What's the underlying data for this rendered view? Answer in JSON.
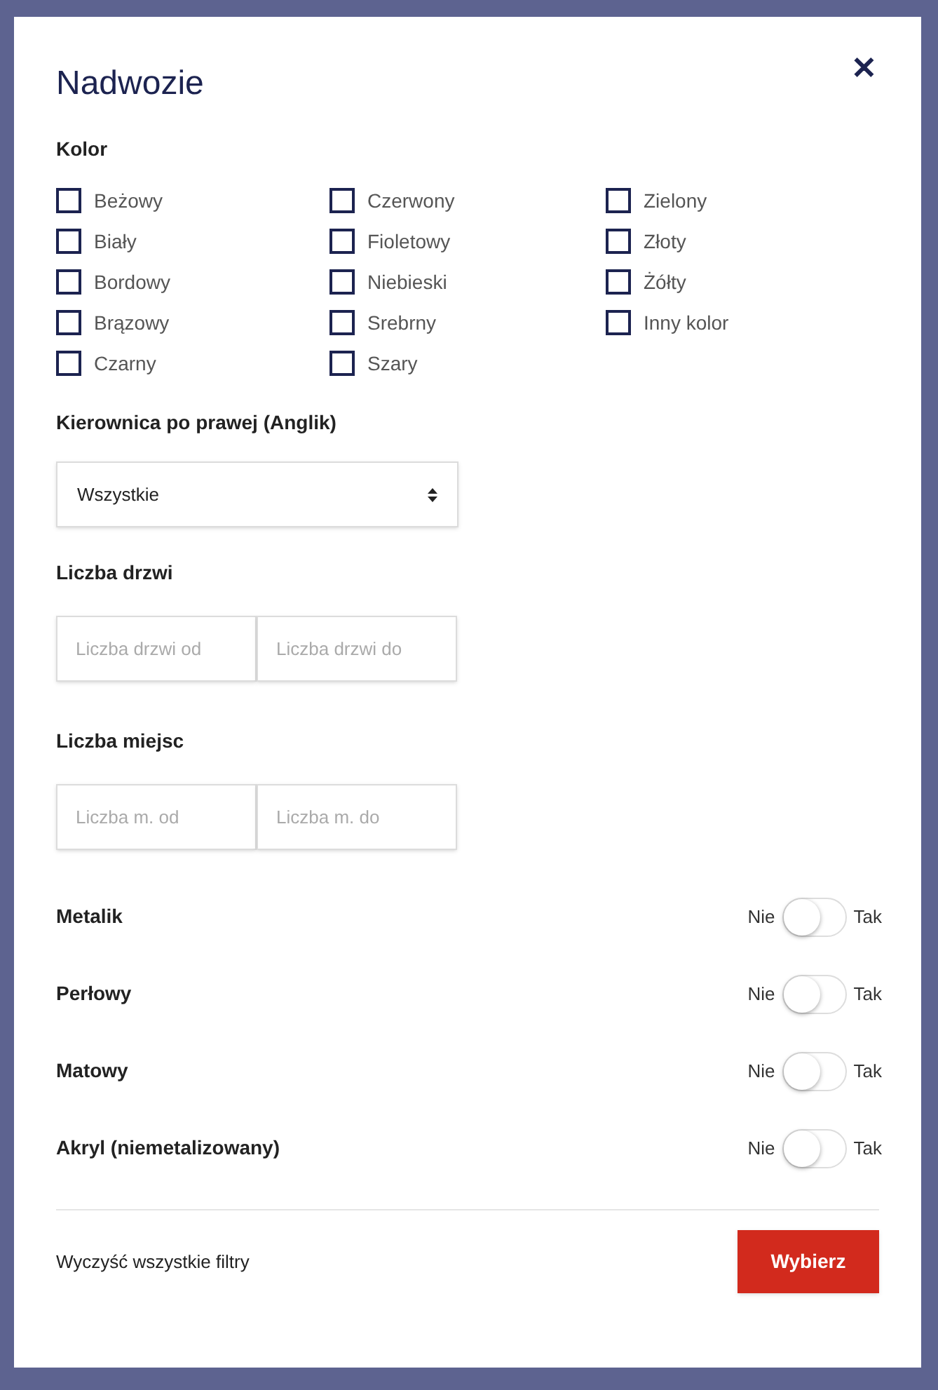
{
  "modal": {
    "title": "Nadwozie",
    "close": "✕"
  },
  "color_section": {
    "label": "Kolor",
    "columns": [
      [
        {
          "label": "Beżowy",
          "checked": false
        },
        {
          "label": "Biały",
          "checked": false
        },
        {
          "label": "Bordowy",
          "checked": false
        },
        {
          "label": "Brązowy",
          "checked": false
        },
        {
          "label": "Czarny",
          "checked": false
        }
      ],
      [
        {
          "label": "Czerwony",
          "checked": false
        },
        {
          "label": "Fioletowy",
          "checked": false
        },
        {
          "label": "Niebieski",
          "checked": false
        },
        {
          "label": "Srebrny",
          "checked": false
        },
        {
          "label": "Szary",
          "checked": false
        }
      ],
      [
        {
          "label": "Zielony",
          "checked": false
        },
        {
          "label": "Złoty",
          "checked": false
        },
        {
          "label": "Żółty",
          "checked": false
        },
        {
          "label": "Inny kolor",
          "checked": false
        }
      ]
    ]
  },
  "steering": {
    "label": "Kierownica po prawej (Anglik)",
    "value": "Wszystkie"
  },
  "ranges": [
    {
      "label": "Liczba drzwi",
      "from_placeholder": "Liczba drzwi od",
      "to_placeholder": "Liczba drzwi do"
    },
    {
      "label": "Liczba miejsc",
      "from_placeholder": "Liczba m. od",
      "to_placeholder": "Liczba m. do"
    }
  ],
  "toggles": [
    {
      "label": "Metalik",
      "off_label": "Nie",
      "on_label": "Tak",
      "on": false
    },
    {
      "label": "Perłowy",
      "off_label": "Nie",
      "on_label": "Tak",
      "on": false
    },
    {
      "label": "Matowy",
      "off_label": "Nie",
      "on_label": "Tak",
      "on": false
    },
    {
      "label": "Akryl (niemetalizowany)",
      "off_label": "Nie",
      "on_label": "Tak",
      "on": false
    }
  ],
  "footer": {
    "clear": "Wyczyść wszystkie filtry",
    "submit": "Wybierz"
  }
}
